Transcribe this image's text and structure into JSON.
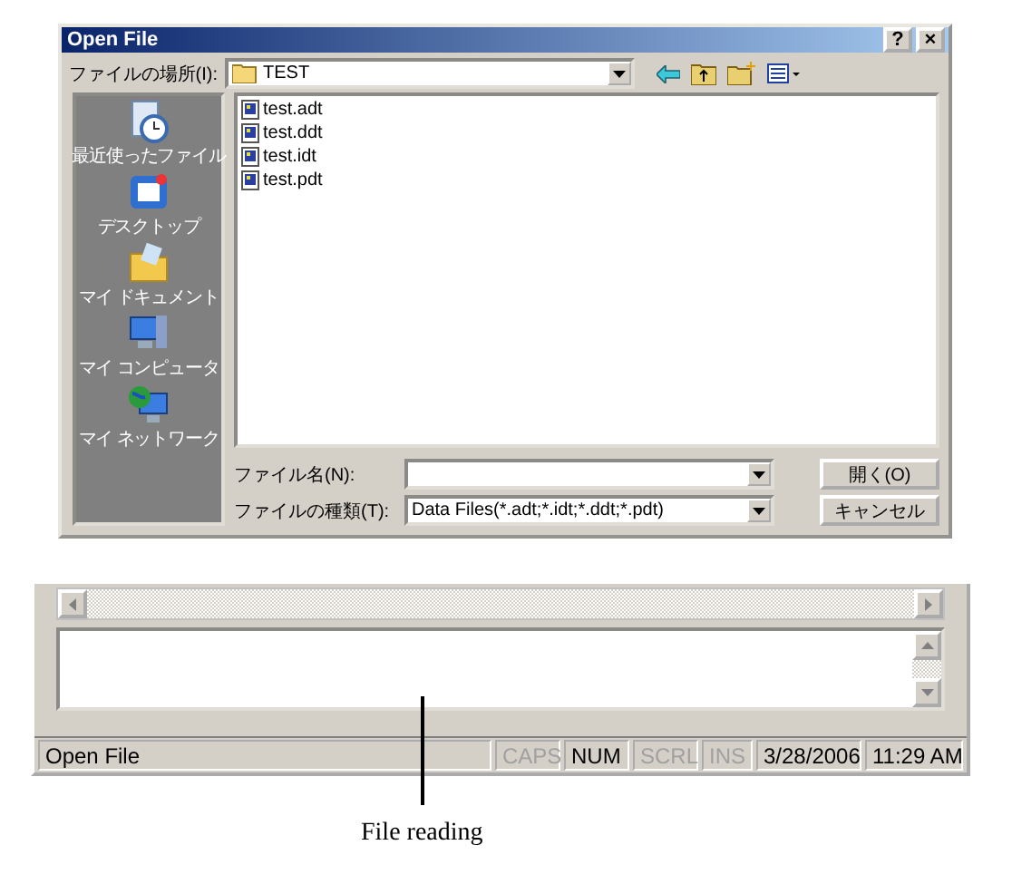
{
  "dialog": {
    "title": "Open File",
    "title_buttons": [
      "?",
      "×"
    ],
    "look_in": {
      "label": "ファイルの場所(I):",
      "value": "TEST"
    },
    "places": [
      "最近使ったファイル",
      "デスクトップ",
      "マイ ドキュメント",
      "マイ コンピュータ",
      "マイ ネットワーク"
    ],
    "files": [
      "test.adt",
      "test.ddt",
      "test.idt",
      "test.pdt"
    ],
    "file_name": {
      "label": "ファイル名(N):"
    },
    "file_type": {
      "label": "ファイルの種類(T):",
      "value": "Data Files(*.adt;*.idt;*.ddt;*.pdt)"
    },
    "buttons": [
      "開く(O)",
      "キャンセル"
    ]
  },
  "app": {
    "status_bar": {
      "message": "Open File",
      "indicators": [
        {
          "label": "CAPS",
          "on": false
        },
        {
          "label": "NUM",
          "on": true
        },
        {
          "label": "SCRL",
          "on": false
        },
        {
          "label": "INS",
          "on": false
        }
      ],
      "date": "3/28/2006",
      "time": "11:29 AM"
    }
  },
  "caption": "File reading"
}
